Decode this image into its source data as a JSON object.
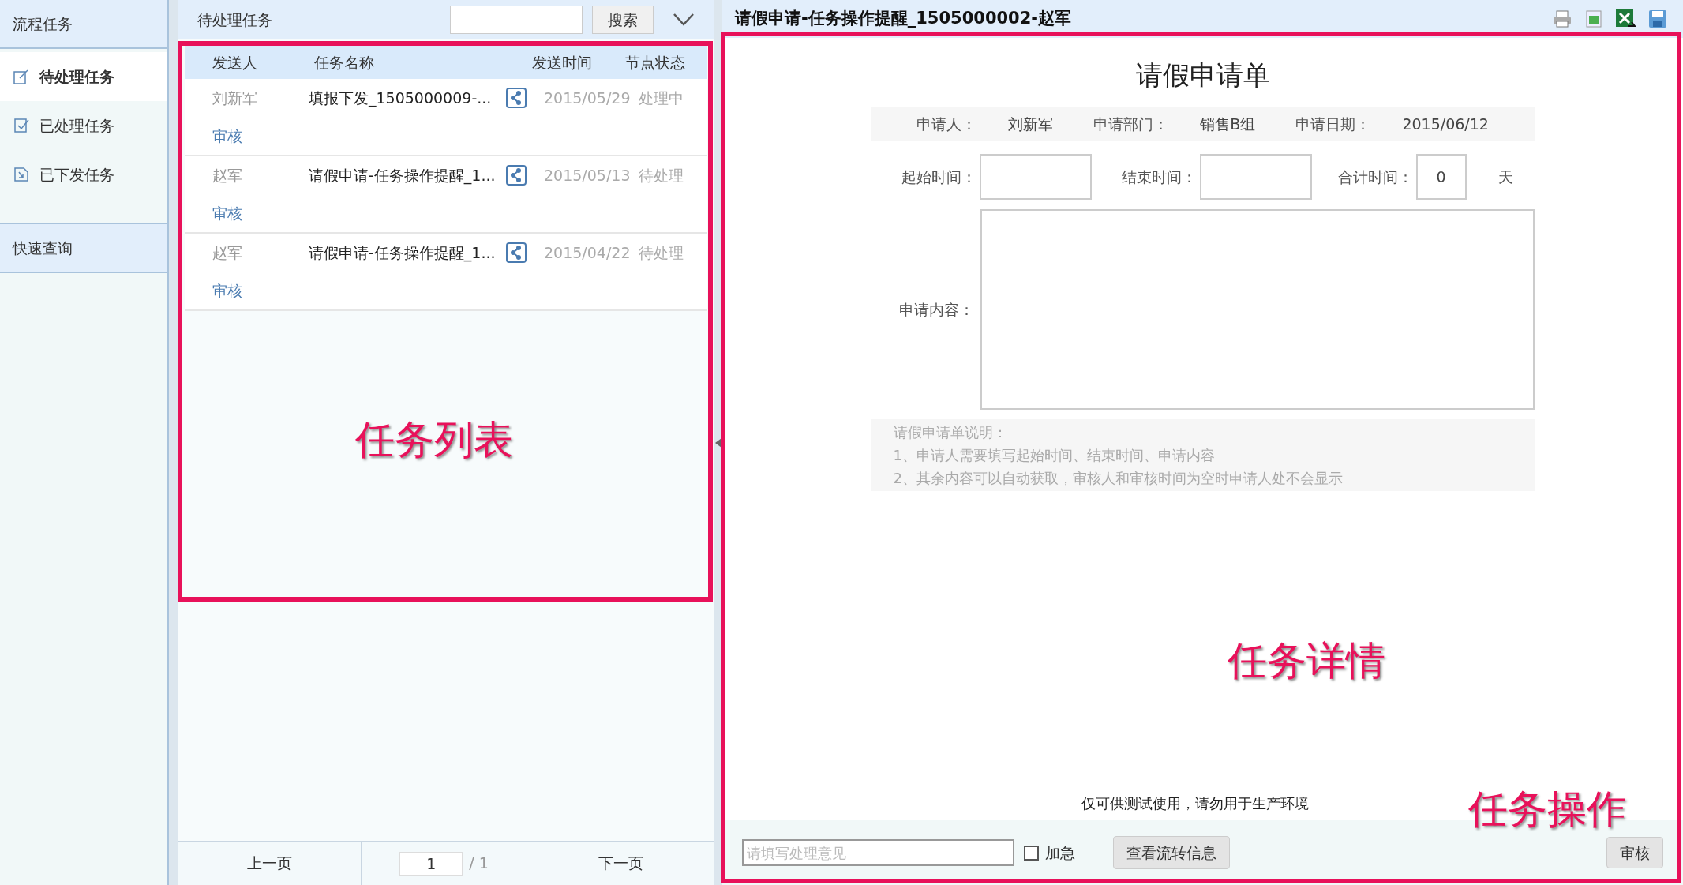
{
  "sidebar": {
    "sections": [
      {
        "title": "流程任务",
        "items": [
          {
            "label": "待处理任务",
            "selected": true
          },
          {
            "label": "已处理任务",
            "selected": false
          },
          {
            "label": "已下发任务",
            "selected": false
          }
        ]
      },
      {
        "title": "快速查询"
      }
    ]
  },
  "task_list": {
    "title": "待处理任务",
    "search": {
      "button": "搜索"
    },
    "columns": [
      "发送人",
      "任务名称",
      "发送时间",
      "节点状态"
    ],
    "rows": [
      {
        "sender": "刘新军",
        "name": "填报下发_1505000009-...",
        "time": "2015/05/29",
        "status": "处理中",
        "action": "审核"
      },
      {
        "sender": "赵军",
        "name": "请假申请-任务操作提醒_1...",
        "time": "2015/05/13",
        "status": "待处理",
        "action": "审核"
      },
      {
        "sender": "赵军",
        "name": "请假申请-任务操作提醒_1...",
        "time": "2015/04/22",
        "status": "待处理",
        "action": "审核"
      }
    ],
    "pager": {
      "prev": "上一页",
      "page": "1",
      "total": "/ 1",
      "next": "下一页"
    }
  },
  "detail": {
    "title": "请假申请-任务操作提醒_1505000002-赵军",
    "form": {
      "title": "请假申请单",
      "info": [
        {
          "label": "申请人：",
          "value": "刘新军"
        },
        {
          "label": "申请部门：",
          "value": "销售B组"
        },
        {
          "label": "申请日期：",
          "value": "2015/06/12"
        }
      ],
      "fields": [
        {
          "label": "起始时间："
        },
        {
          "label": "结束时间："
        },
        {
          "label": "合计时间：",
          "value": "0",
          "unit": "天"
        }
      ],
      "content_label": "申请内容：",
      "notes": [
        "请假申请单说明：",
        "1、申请人需要填写起始时间、结束时间、申请内容",
        "2、其余内容可以自动获取，审核人和审核时间为空时申请人处不会显示"
      ]
    },
    "notice": "仅可供测试使用，请勿用于生产环境",
    "actions": {
      "opinion_placeholder": "请填写处理意见",
      "urgent": {
        "label": "加急",
        "checked": false
      },
      "flow_button": "查看流转信息",
      "approve_button": "审核"
    }
  },
  "annotations": [
    "任务列表",
    "任务详情",
    "任务操作"
  ]
}
